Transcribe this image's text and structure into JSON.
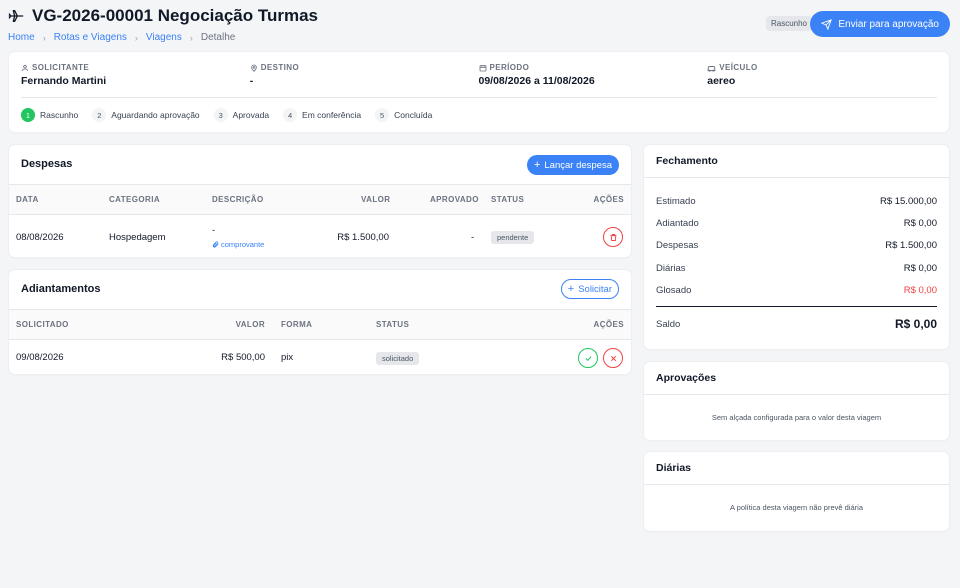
{
  "header": {
    "title": "VG-2026-00001 Negociação Turmas",
    "breadcrumb": [
      "Home",
      "Rotas e Viagens",
      "Viagens",
      "Detalhe"
    ],
    "status_badge": "Rascunho",
    "send_button": "Enviar para aprovação"
  },
  "info": {
    "solicitante_label": "SOLICITANTE",
    "solicitante": "Fernando Martini",
    "destino_label": "DESTINO",
    "destino": "-",
    "periodo_label": "PERÍODO",
    "periodo": "09/08/2026 a 11/08/2026",
    "veiculo_label": "VEÍCULO",
    "veiculo": "aereo"
  },
  "steps": [
    {
      "num": "1",
      "label": "Rascunho"
    },
    {
      "num": "2",
      "label": "Aguardando aprovação"
    },
    {
      "num": "3",
      "label": "Aprovada"
    },
    {
      "num": "4",
      "label": "Em conferência"
    },
    {
      "num": "5",
      "label": "Concluída"
    }
  ],
  "despesas": {
    "title": "Despesas",
    "add_button": "Lançar despesa",
    "columns": {
      "data": "DATA",
      "categoria": "CATEGORIA",
      "descricao": "DESCRIÇÃO",
      "valor": "VALOR",
      "aprovado": "APROVADO",
      "status": "STATUS",
      "acoes": "AÇÕES"
    },
    "rows": [
      {
        "data": "08/08/2026",
        "categoria": "Hospedagem",
        "descricao": "-",
        "comprovante": "comprovante",
        "valor": "R$ 1.500,00",
        "aprovado": "-",
        "status": "pendente"
      }
    ]
  },
  "adiantamentos": {
    "title": "Adiantamentos",
    "add_button": "Solicitar",
    "columns": {
      "solicitado": "SOLICITADO",
      "valor": "VALOR",
      "forma": "FORMA",
      "status": "STATUS",
      "acoes": "AÇÕES"
    },
    "rows": [
      {
        "solicitado": "09/08/2026",
        "valor": "R$ 500,00",
        "forma": "pix",
        "status": "solicitado"
      }
    ]
  },
  "fechamento": {
    "title": "Fechamento",
    "rows": [
      {
        "label": "Estimado",
        "value": "R$ 15.000,00"
      },
      {
        "label": "Adiantado",
        "value": "R$ 0,00"
      },
      {
        "label": "Despesas",
        "value": "R$ 1.500,00"
      },
      {
        "label": "Diárias",
        "value": "R$ 0,00"
      },
      {
        "label": "Glosado",
        "value": "R$ 0,00"
      }
    ],
    "saldo_label": "Saldo",
    "saldo_value": "R$ 0,00"
  },
  "aprovacoes": {
    "title": "Aprovações",
    "empty": "Sem alçada configurada para o valor desta viagem"
  },
  "diarias": {
    "title": "Diárias",
    "empty": "A política desta viagem não prevê diária"
  },
  "colors": {
    "accent": "#3b82f6",
    "success": "#22c55e",
    "danger": "#ef4444"
  }
}
